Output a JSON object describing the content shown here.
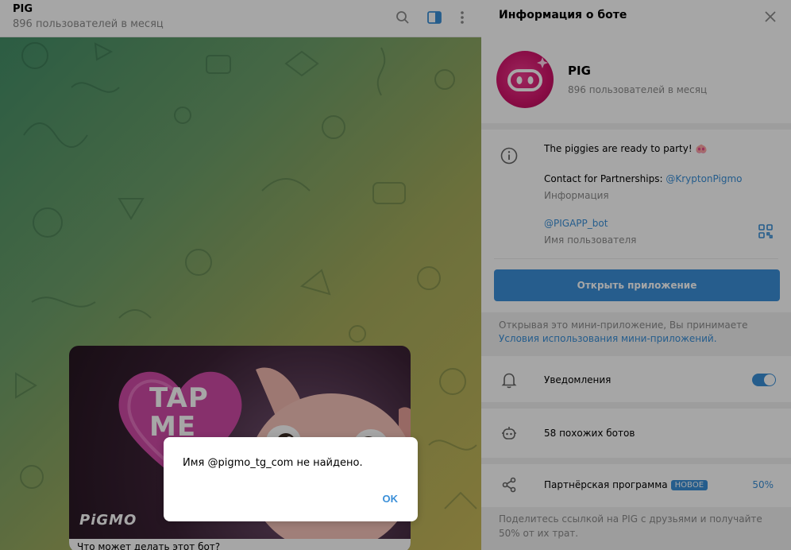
{
  "chat": {
    "title": "PIG",
    "subtitle": "896 пользователей в месяц",
    "card": {
      "tap_text": "TAP\nME",
      "logo": "PiGMO",
      "caption": "Что может делать этот бот?"
    }
  },
  "dialog": {
    "message": "Имя @pigmo_tg_com не найдено.",
    "ok_label": "OK"
  },
  "panel": {
    "title": "Информация о боте",
    "bot_name": "PIG",
    "bot_users": "896 пользователей в месяц",
    "description_line1": "The piggies are ready to party! 🐽",
    "partners_prefix": "Contact for Partnerships: ",
    "partners_link": "@KryptonPigmo",
    "info_label": "Информация",
    "username": "@PIGAPP_bot",
    "username_label": "Имя пользователя",
    "open_app_label": "Открыть приложение",
    "terms_text": "Открывая это мини-приложение, Вы принимаете",
    "terms_link": "Условия использования мини-приложений.",
    "notifications_label": "Уведомления",
    "notifications_on": true,
    "similar_bots": "58 похожих ботов",
    "affiliate_label": "Партнёрская программа",
    "affiliate_badge": "НОВОЕ",
    "affiliate_percent": "50%",
    "affiliate_note_line1": "Поделитесь ссылкой на PIG с друзьями и получайте",
    "affiliate_note_line2": "50% от их трат."
  },
  "colors": {
    "accent": "#3a8fd8",
    "avatar": "#d2136a"
  }
}
